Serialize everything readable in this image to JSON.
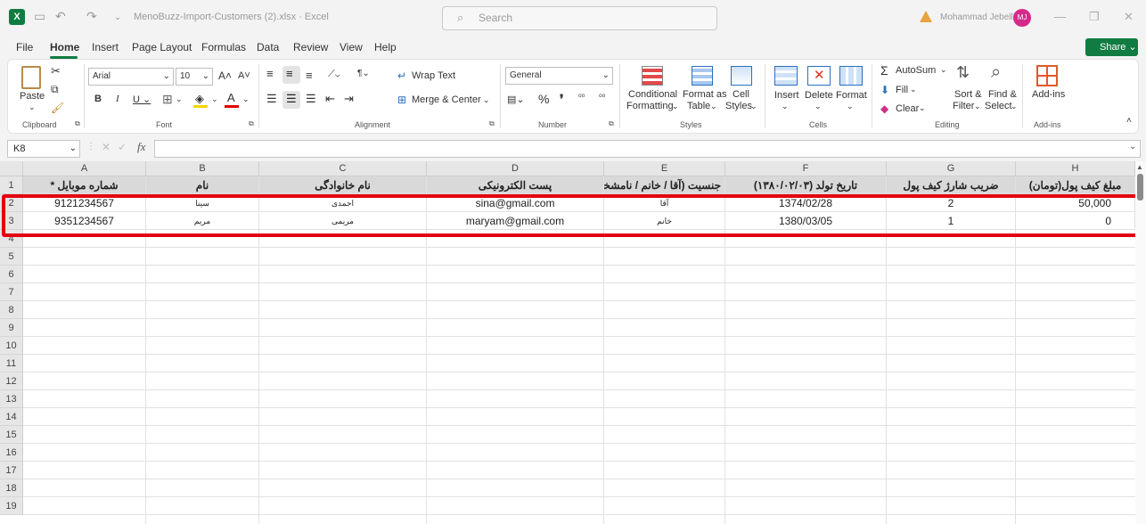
{
  "titlebar": {
    "logo": "X",
    "doc_title": "MenoBuzz-Import-Customers (2).xlsx  ·  Excel",
    "search_placeholder": "Search",
    "user_name": "Mohammad Jebelli",
    "user_initials": "MJ"
  },
  "menu": {
    "tabs": [
      "File",
      "Home",
      "Insert",
      "Page Layout",
      "Formulas",
      "Data",
      "Review",
      "View",
      "Help"
    ],
    "share_label": "Share"
  },
  "ribbon": {
    "clipboard": {
      "paste": "Paste",
      "label": "Clipboard"
    },
    "font": {
      "name": "Arial",
      "size": "10",
      "label": "Font"
    },
    "alignment": {
      "wrap": "Wrap Text",
      "merge": "Merge & Center",
      "label": "Alignment"
    },
    "number": {
      "format": "General",
      "label": "Number"
    },
    "styles": {
      "cond1": "Conditional",
      "cond2": "Formatting",
      "fmt1": "Format as",
      "fmt2": "Table",
      "cell1": "Cell",
      "cell2": "Styles",
      "label": "Styles"
    },
    "cells": {
      "insert": "Insert",
      "delete": "Delete",
      "format": "Format",
      "label": "Cells"
    },
    "editing": {
      "autosum": "AutoSum",
      "fill": "Fill",
      "clear": "Clear",
      "sort1": "Sort &",
      "sort2": "Filter",
      "find1": "Find &",
      "find2": "Select",
      "label": "Editing"
    },
    "addins": {
      "btn": "Add-ins",
      "label": "Add-ins"
    }
  },
  "formula_bar": {
    "name_box": "K8",
    "fx": "fx",
    "value": ""
  },
  "sheet": {
    "columns": [
      "A",
      "B",
      "C",
      "D",
      "E",
      "F",
      "G",
      "H"
    ],
    "rows": [
      "1",
      "2",
      "3",
      "4",
      "5",
      "6",
      "7",
      "8",
      "9",
      "10",
      "11",
      "12",
      "13",
      "14",
      "15",
      "16",
      "17",
      "18",
      "19"
    ],
    "header": [
      "شماره موبایل *",
      "نام",
      "نام خانوادگی",
      "پست الکترونیکی",
      "جنسیت (آقا / خانم / نامشخص)",
      "تاریخ تولد (۱۳۸۰/۰۲/۰۳)",
      "ضریب شارژ کیف پول",
      "مبلغ کیف پول(تومان)"
    ],
    "data": [
      [
        "9121234567",
        "سینا",
        "احمدی",
        "sina@gmail.com",
        "آقا",
        "1374/02/28",
        "2",
        "50,000"
      ],
      [
        "9351234567",
        "مریم",
        "مریمی",
        "maryam@gmail.com",
        "خانم",
        "1380/03/05",
        "1",
        "0"
      ]
    ]
  },
  "colors": {
    "accent": "#107c41",
    "highlight": "#e3000f"
  }
}
